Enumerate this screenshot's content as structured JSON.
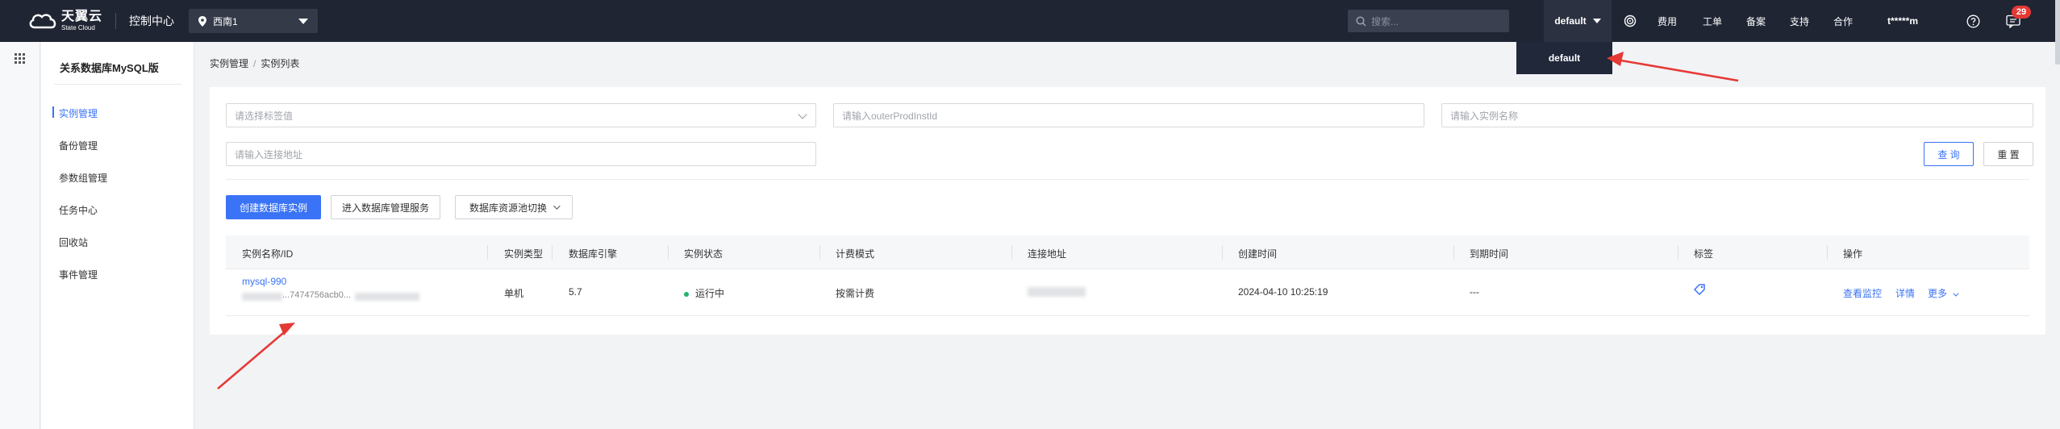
{
  "topbar": {
    "brand_cn": "天翼云",
    "brand_en": "State Cloud",
    "console": "控制中心",
    "region": "西南1",
    "search_placeholder": "搜索...",
    "account": "default",
    "nav": [
      "费用",
      "工单",
      "备案",
      "支持",
      "合作"
    ],
    "user": "t*****m",
    "badge_count": "29",
    "dropdown_option": "default"
  },
  "sidebar": {
    "title": "关系数据库MySQL版",
    "items": [
      "实例管理",
      "备份管理",
      "参数组管理",
      "任务中心",
      "回收站",
      "事件管理"
    ]
  },
  "breadcrumb": [
    "实例管理",
    "实例列表"
  ],
  "filters": {
    "tag_placeholder": "请选择标签值",
    "outer_id_placeholder": "请输入outerProdInstId",
    "name_placeholder": "请输入实例名称",
    "address_placeholder": "请输入连接地址",
    "query": "查 询",
    "reset": "重 置"
  },
  "actions": {
    "create": "创建数据库实例",
    "enter_manage": "进入数据库管理服务",
    "switch": "数据库资源池切换"
  },
  "table": {
    "headers": [
      "实例名称/ID",
      "实例类型",
      "数据库引擎",
      "实例状态",
      "计费模式",
      "连接地址",
      "创建时间",
      "到期时间",
      "标签",
      "操作"
    ],
    "rows": [
      {
        "name": "mysql-990",
        "id_partial": "...7474756acb0...",
        "type": "单机",
        "engine": "5.7",
        "status": "运行中",
        "billing": "按需计费",
        "created": "2024-04-10 10:25:19",
        "expires": "---",
        "ops": [
          "查看监控",
          "详情",
          "更多"
        ]
      }
    ]
  },
  "colors": {
    "accent": "#3a73f6",
    "topbar": "#1f2533",
    "status_running": "#24b36a",
    "annotation_arrow": "#e53935"
  }
}
